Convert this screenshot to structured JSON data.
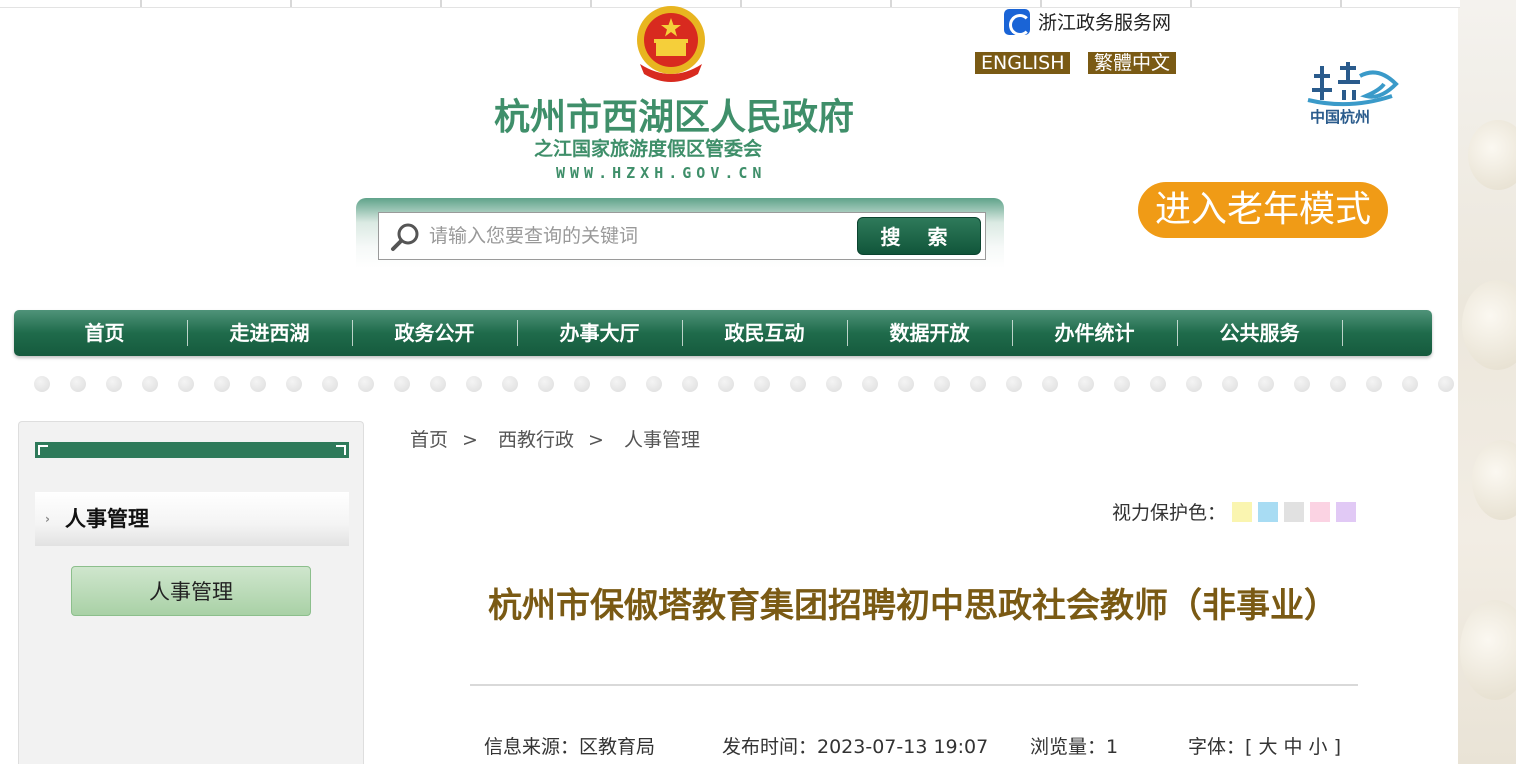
{
  "header": {
    "site_title": "杭州市西湖区人民政府",
    "site_subtitle": "之江国家旅游度假区管委会",
    "site_url": "WWW.HZXH.GOV.CN",
    "zj_link": "浙江政务服务网",
    "lang_english": "ENGLISH",
    "lang_traditional": "繁體中文",
    "city_logo_text": "中国杭州",
    "elder_mode": "进入老年模式"
  },
  "search": {
    "placeholder": "请输入您要查询的关键词",
    "button": "搜 索"
  },
  "nav": {
    "items": [
      "首页",
      "走进西湖",
      "政务公开",
      "办事大厅",
      "政民互动",
      "数据开放",
      "办件统计",
      "公共服务"
    ]
  },
  "sidebar": {
    "heading": "人事管理",
    "link": "人事管理"
  },
  "breadcrumb": {
    "items": [
      "首页",
      "西教行政",
      "人事管理"
    ],
    "separator": ">"
  },
  "eye_protect": {
    "label": "视力保护色：",
    "colors": [
      "#faf5b0",
      "#a8dcf3",
      "#e1e1e1",
      "#fbd3e3",
      "#e1c9f5"
    ]
  },
  "article": {
    "title": "杭州市保俶塔教育集团招聘初中思政社会教师（非事业）",
    "source": "信息来源：区教育局",
    "publish_time": "发布时间：2023-07-13 19:07",
    "views": "浏览量：1",
    "font_size": "字体：[ 大 中 小 ]"
  },
  "colors": {
    "brand_green": "#1f6b4b",
    "title_brown": "#7a5a14",
    "elder_orange": "#f09b16"
  }
}
